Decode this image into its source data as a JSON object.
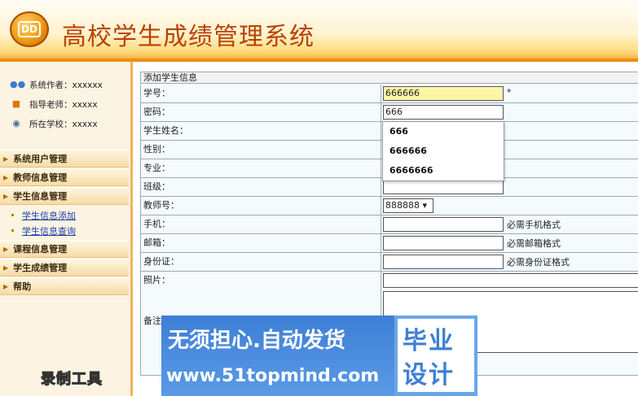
{
  "header": {
    "title": "高校学生成绩管理系统",
    "logo_text": "DD"
  },
  "sidebar": {
    "info": [
      {
        "icon": "users-icon",
        "text": "系统作者：xxxxxx"
      },
      {
        "icon": "hat-icon",
        "text": "指导老师：xxxxx"
      },
      {
        "icon": "globe-icon",
        "text": "所在学校：xxxxx"
      }
    ],
    "menu": [
      {
        "label": "系统用户管理"
      },
      {
        "label": "教师信息管理"
      },
      {
        "label": "学生信息管理"
      },
      {
        "label": "课程信息管理"
      },
      {
        "label": "学生成绩管理"
      },
      {
        "label": "帮助"
      }
    ],
    "submenu": [
      {
        "label": "学生信息添加"
      },
      {
        "label": "学生信息查询"
      }
    ],
    "recording_label": "录制工具"
  },
  "form": {
    "title": "添加学生信息",
    "rows": [
      {
        "label": "学号：",
        "value": "666666",
        "hint": "*"
      },
      {
        "label": "密码：",
        "value": "666",
        "hint": ""
      },
      {
        "label": "学生姓名：",
        "value": "",
        "hint": ""
      },
      {
        "label": "性别：",
        "value": "",
        "hint": ""
      },
      {
        "label": "专业：",
        "value": "",
        "hint": ""
      },
      {
        "label": "班级：",
        "value": "",
        "hint": ""
      },
      {
        "label": "教师号：",
        "value": "888888 ▾",
        "hint": ""
      },
      {
        "label": "手机：",
        "value": "",
        "hint": "必需手机格式"
      },
      {
        "label": "邮箱：",
        "value": "",
        "hint": "必需邮箱格式"
      },
      {
        "label": "身份证：",
        "value": "",
        "hint": "必需身份证格式"
      },
      {
        "label": "照片：",
        "value": "",
        "hint": ""
      }
    ],
    "memo_label": "备注："
  },
  "autocomplete": {
    "options": [
      "666",
      "666666",
      "6666666"
    ]
  },
  "watermark": {
    "headline": "无须担心.自动发货",
    "url": "www.51topmind.com",
    "badge_line1": "毕业",
    "badge_line2": "设计"
  }
}
